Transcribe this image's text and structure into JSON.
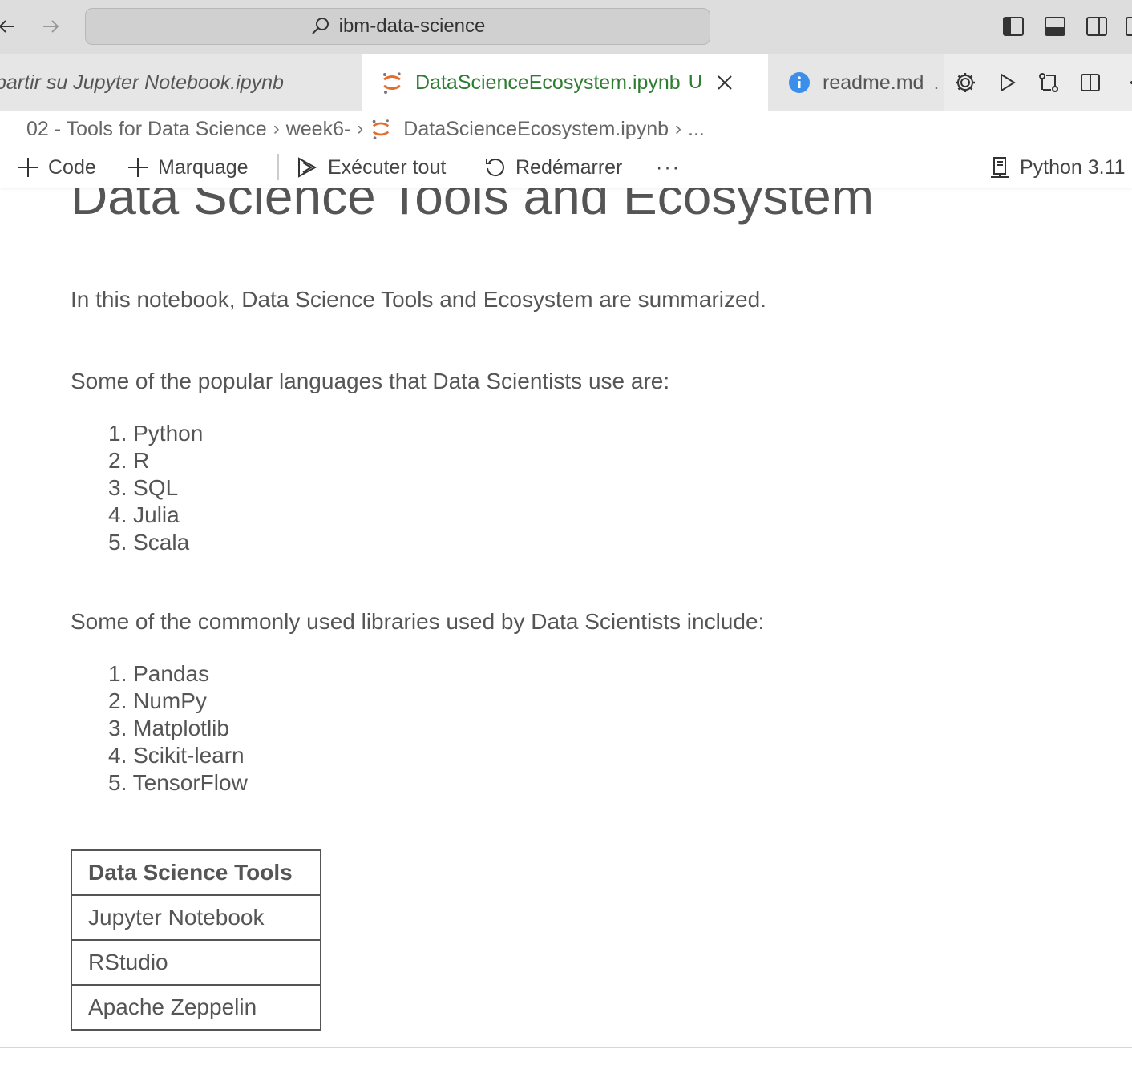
{
  "addressbar": {
    "text": "ibm-data-science"
  },
  "tabs": [
    {
      "label": "partir su Jupyter Notebook.ipynb",
      "state": "inactive",
      "icon": "none"
    },
    {
      "label": "DataScienceEcosystem.ipynb",
      "modified": "U",
      "state": "active",
      "icon": "jupyter-icon"
    },
    {
      "label": "readme.md",
      "suffix": ".",
      "state": "inactive",
      "icon": "info-icon"
    }
  ],
  "breadcrumb": {
    "items": [
      "02 - Tools for Data Science",
      "week6-",
      "DataScienceEcosystem.ipynb",
      "..."
    ]
  },
  "toolbar": {
    "code_label": "Code",
    "markdown_label": "Marquage",
    "run_all_label": "Exécuter tout",
    "restart_label": "Redémarrer",
    "more_label": "···",
    "kernel_label": "Python 3.11"
  },
  "notebook": {
    "title": "Data Science Tools and Ecosystem",
    "intro": "In this notebook, Data Science Tools and Ecosystem are summarized.",
    "languages_heading": "Some of the popular languages that Data Scientists use are:",
    "languages": [
      "1. Python",
      "2. R",
      "3. SQL",
      "4. Julia",
      "5. Scala"
    ],
    "libraries_heading": "Some of the commonly used libraries used by Data Scientists include:",
    "libraries": [
      "1. Pandas",
      "2. NumPy",
      "3. Matplotlib",
      "4. Scikit-learn",
      "5. TensorFlow"
    ],
    "table": {
      "header": "Data Science Tools",
      "rows": [
        "Jupyter Notebook",
        "RStudio",
        "Apache Zeppelin"
      ]
    }
  },
  "colors": {
    "active_tab_text": "#2e7d32",
    "jupyter_orange": "#e46e2e",
    "info_blue": "#3b8eea"
  }
}
